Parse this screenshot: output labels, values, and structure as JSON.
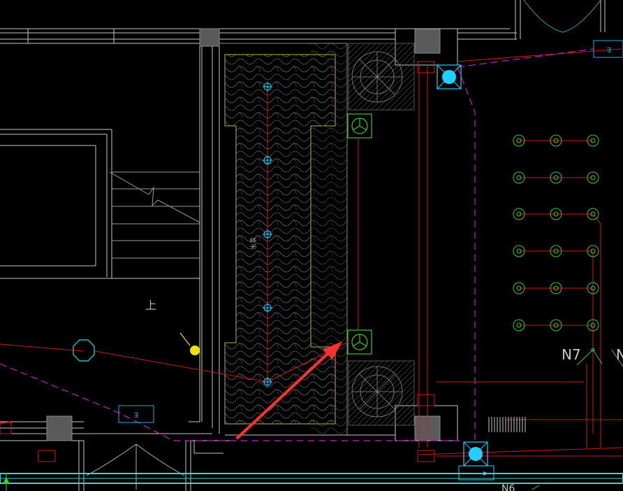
{
  "drawing": {
    "background": "#000000",
    "colors": {
      "wall": "#c8c8c8",
      "wall_dim": "#8a8a8a",
      "pipe": "#d01818",
      "dashed_line": "#c020c0",
      "lamp": "#20d0ff",
      "fixture": "#38c838",
      "arrow": "#ff3030",
      "yellow": "#f0e000",
      "column": "#5a5a5a",
      "cyan_bar": "#40d0d0",
      "planter_border": "#b8b050"
    }
  },
  "labels": {
    "stair_text": "上",
    "vertical_note": "水景",
    "tag_left": "E",
    "tag_top_right": "E",
    "circuit_n7": "N7",
    "circuit_n8": "N",
    "circuit_bottom": "N6"
  },
  "icons": {
    "fan_top": "ceiling-fan-icon",
    "fan_bottom": "ceiling-fan-icon",
    "lamp_top": "cyan-lamp-icon",
    "lamp_bottom": "cyan-lamp-icon"
  }
}
